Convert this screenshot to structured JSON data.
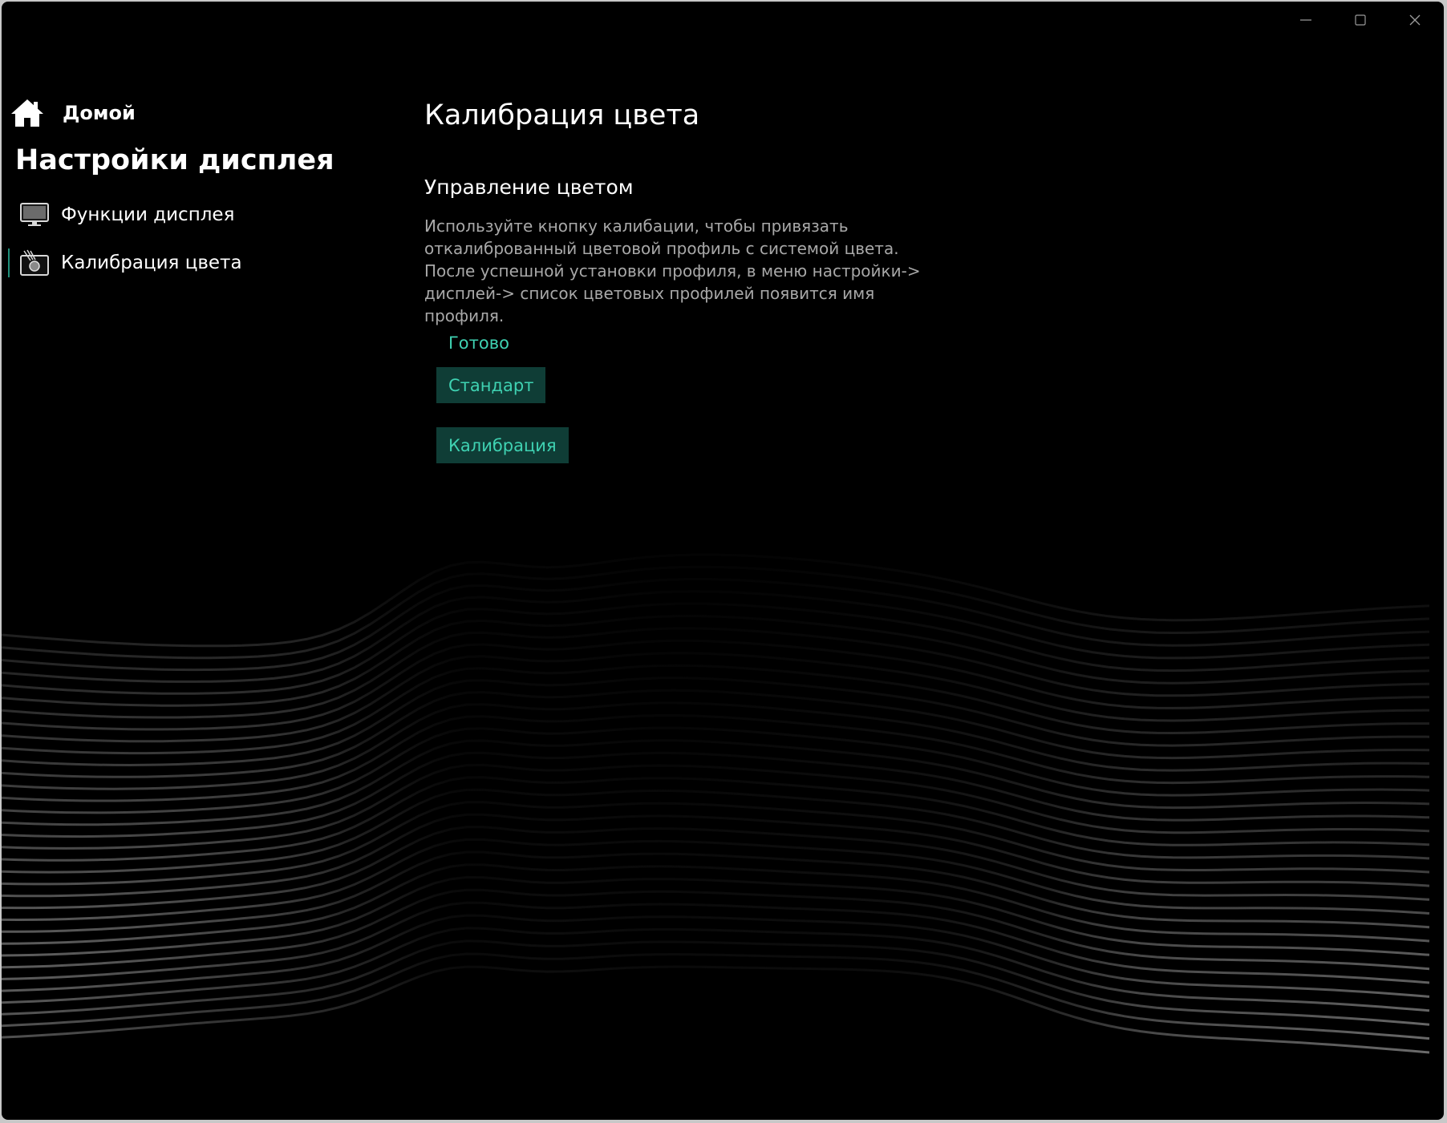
{
  "window": {
    "controls": {
      "minimize_icon": "minimize-icon",
      "maximize_icon": "maximize-icon",
      "close_icon": "close-icon"
    }
  },
  "sidebar": {
    "home": {
      "label": "Домой",
      "icon": "home-icon"
    },
    "title": "Настройки дисплея",
    "items": [
      {
        "label": "Функции дисплея",
        "icon": "monitor-icon",
        "active": false
      },
      {
        "label": "Калибрация цвета",
        "icon": "calibration-icon",
        "active": true
      }
    ]
  },
  "main": {
    "title": "Калибрация цвета",
    "section": {
      "title": "Управление цветом",
      "description_lines": [
        "Используйте кнопку калибации, чтобы привязать",
        "откалиброванный цветовой профиль с системой цвета.",
        "После успешной установки профиля, в меню настройки->",
        "дисплей-> список цветовых профилей появится имя",
        "профиля."
      ],
      "status": "Готово",
      "buttons": {
        "standard_label": "Стандарт",
        "calibrate_label": "Калибрация"
      }
    }
  },
  "colors": {
    "background": "#000000",
    "accent_text": "#3fd2b2",
    "button_bg": "#0f3d36",
    "description_text": "#a8a8a8"
  }
}
